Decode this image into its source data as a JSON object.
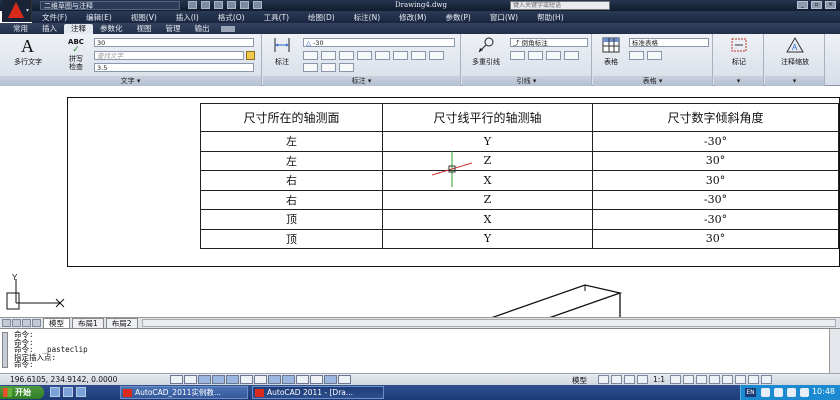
{
  "titlebar": {
    "workspace": "二维草图与注释",
    "document": "Drawing4.dwg",
    "search_placeholder": "键入关键字或短语"
  },
  "menu": [
    "文件(F)",
    "编辑(E)",
    "视图(V)",
    "插入(I)",
    "格式(O)",
    "工具(T)",
    "绘图(D)",
    "标注(N)",
    "修改(M)",
    "参数(P)",
    "窗口(W)",
    "帮助(H)"
  ],
  "ribbon_tabs": [
    "常用",
    "插入",
    "注释",
    "参数化",
    "视图",
    "管理",
    "输出"
  ],
  "active_ribbon_tab": "注释",
  "ribbon": {
    "text_panel": {
      "mtext_label": "多行文字",
      "spell_top": "ABC",
      "spell_label": "拼写检查",
      "style_value": "30",
      "find_placeholder": "查找文字",
      "height_value": "3.5",
      "panel_label": "文字"
    },
    "dim_panel": {
      "dim_label": "标注",
      "angle_value": "-30",
      "panel_label": "标注"
    },
    "leader_panel": {
      "mleader_label": "多重引线",
      "style_value": "倒角标注",
      "panel_label": "引线"
    },
    "table_panel": {
      "table_label": "表格",
      "style_value": "标准表格",
      "panel_label": "表格"
    },
    "markup_panel": {
      "label": "标记"
    },
    "scale_panel": {
      "label": "注释缩放"
    }
  },
  "table": {
    "headers": [
      "尺寸所在的轴测面",
      "尺寸线平行的轴测轴",
      "尺寸数字倾斜角度"
    ],
    "rows": [
      [
        "左",
        "Y",
        "-30°"
      ],
      [
        "左",
        "Z",
        "30°"
      ],
      [
        "右",
        "X",
        "30°"
      ],
      [
        "右",
        "Z",
        "-30°"
      ],
      [
        "顶",
        "X",
        "-30°"
      ],
      [
        "顶",
        "Y",
        "30°"
      ]
    ]
  },
  "ucs": {
    "y_label": "Y"
  },
  "layout_tabs": [
    "模型",
    "布局1",
    "布局2"
  ],
  "active_layout_tab": "模型",
  "command_lines": [
    "命令:",
    "命令:",
    "命令:  _pasteclip",
    "指定插入点:",
    "命令:"
  ],
  "status": {
    "coordinates": "196.6105, 234.9142, 0.0000",
    "model_label": "模型",
    "annotation_scale": "1:1"
  },
  "taskbar": {
    "start_label": "开始",
    "buttons": [
      "AutoCAD_2011实例教...",
      "AutoCAD 2011 - [Dra..."
    ],
    "language": "EN",
    "clock": "10:48"
  },
  "colors": {
    "app_logo": "#d92a1c",
    "titlebar": "#1a2436",
    "taskbar": "#2f4f8f",
    "tray": "#1b8ad0",
    "crosshair_green": "#2aa52a",
    "crosshair_red": "#d23030"
  }
}
